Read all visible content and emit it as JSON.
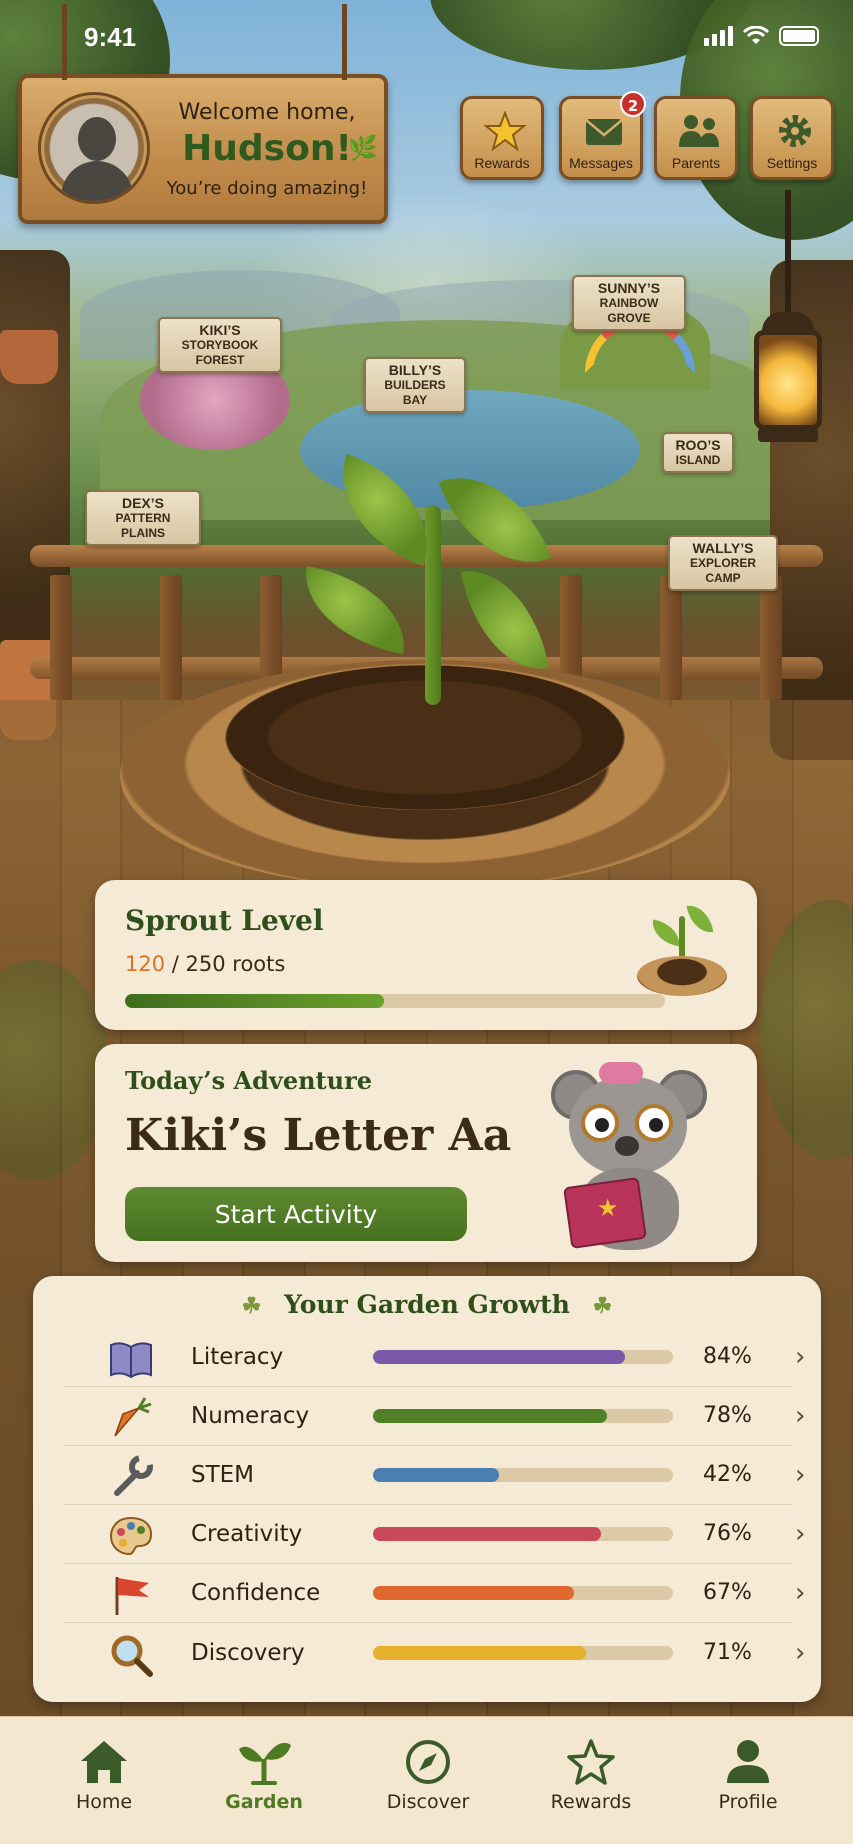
{
  "status_bar": {
    "time": "9:41"
  },
  "welcome": {
    "greeting": "Welcome home,",
    "name": "Hudson!",
    "tagline": "You’re doing amazing!"
  },
  "top_buttons": [
    {
      "label": "Rewards",
      "icon": "star-icon"
    },
    {
      "label": "Messages",
      "icon": "envelope-icon",
      "badge": "2"
    },
    {
      "label": "Parents",
      "icon": "parents-icon"
    },
    {
      "label": "Settings",
      "icon": "gear-icon"
    }
  ],
  "map_locations": [
    {
      "name": "KIKI’S",
      "place": "STORYBOOK FOREST"
    },
    {
      "name": "BILLY’S",
      "place": "BUILDERS BAY"
    },
    {
      "name": "SUNNY’S",
      "place": "RAINBOW GROVE"
    },
    {
      "name": "ROO’S",
      "place": "ISLAND"
    },
    {
      "name": "DEX’S",
      "place": "PATTERN PLAINS"
    },
    {
      "name": "WALLY’S",
      "place": "EXPLORER CAMP"
    }
  ],
  "sprout": {
    "title": "Sprout Level",
    "current": "120",
    "rest": " / 250 roots",
    "progress": 0.48
  },
  "adventure": {
    "subtitle": "Today’s Adventure",
    "title": "Kiki’s Letter Aa",
    "button": "Start Activity"
  },
  "growth": {
    "title": "Your Garden Growth",
    "rows": [
      {
        "label": "Literacy",
        "percent": "84%",
        "value": 0.84,
        "color": "#7a5aa8",
        "icon": "book-icon"
      },
      {
        "label": "Numeracy",
        "percent": "78%",
        "value": 0.78,
        "color": "#4f7f26",
        "icon": "carrot-icon"
      },
      {
        "label": "STEM",
        "percent": "42%",
        "value": 0.42,
        "color": "#4a7fb0",
        "icon": "wrench-icon"
      },
      {
        "label": "Creativity",
        "percent": "76%",
        "value": 0.76,
        "color": "#c9485a",
        "icon": "palette-icon"
      },
      {
        "label": "Confidence",
        "percent": "67%",
        "value": 0.67,
        "color": "#e0672e",
        "icon": "flag-icon"
      },
      {
        "label": "Discovery",
        "percent": "71%",
        "value": 0.71,
        "color": "#e6b12a",
        "icon": "magnifier-icon"
      }
    ]
  },
  "nav": [
    {
      "label": "Home",
      "icon": "home-icon",
      "active": false
    },
    {
      "label": "Garden",
      "icon": "sprout-icon",
      "active": true
    },
    {
      "label": "Discover",
      "icon": "compass-icon",
      "active": false
    },
    {
      "label": "Rewards",
      "icon": "star-outline-icon",
      "active": false
    },
    {
      "label": "Profile",
      "icon": "person-icon",
      "active": false
    }
  ],
  "colors": {
    "accent_green": "#4f7a24",
    "progress_orange": "#d4752a",
    "badge_red": "#c9302c"
  }
}
